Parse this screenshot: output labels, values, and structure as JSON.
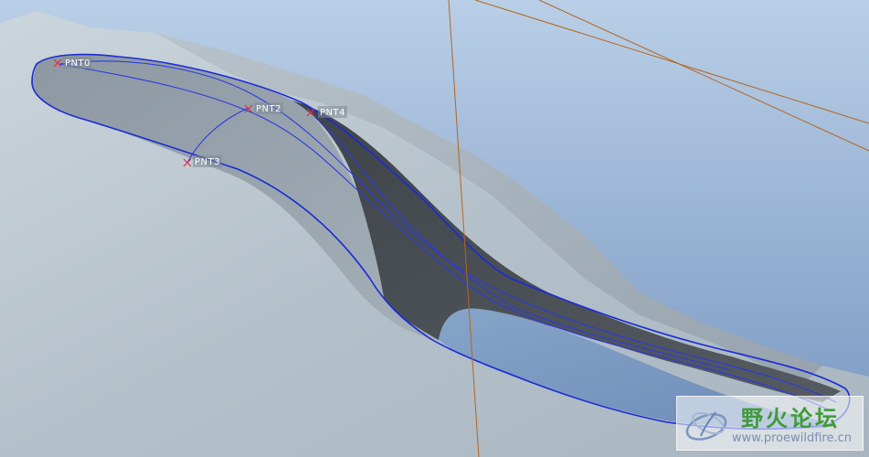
{
  "points": [
    {
      "label": "PNT0"
    },
    {
      "label": "PNT2"
    },
    {
      "label": "PNT4"
    },
    {
      "label": "PNT3"
    }
  ],
  "watermark": {
    "title": "野火论坛",
    "url": "www.proewildfire.cn"
  },
  "colors": {
    "background_top": "#b7cde6",
    "background_bottom": "#7f9fc6",
    "surface_light": "#c2ccd4",
    "surface_mid": "#9aa6b0",
    "cavity_dark": "#4a4f55",
    "edge_blue": "#1a2bd6",
    "datum_orange": "#b5651d",
    "point_marker": "#e0304a"
  },
  "icons": [
    "point-marker-icon",
    "watermark-logo-icon"
  ]
}
